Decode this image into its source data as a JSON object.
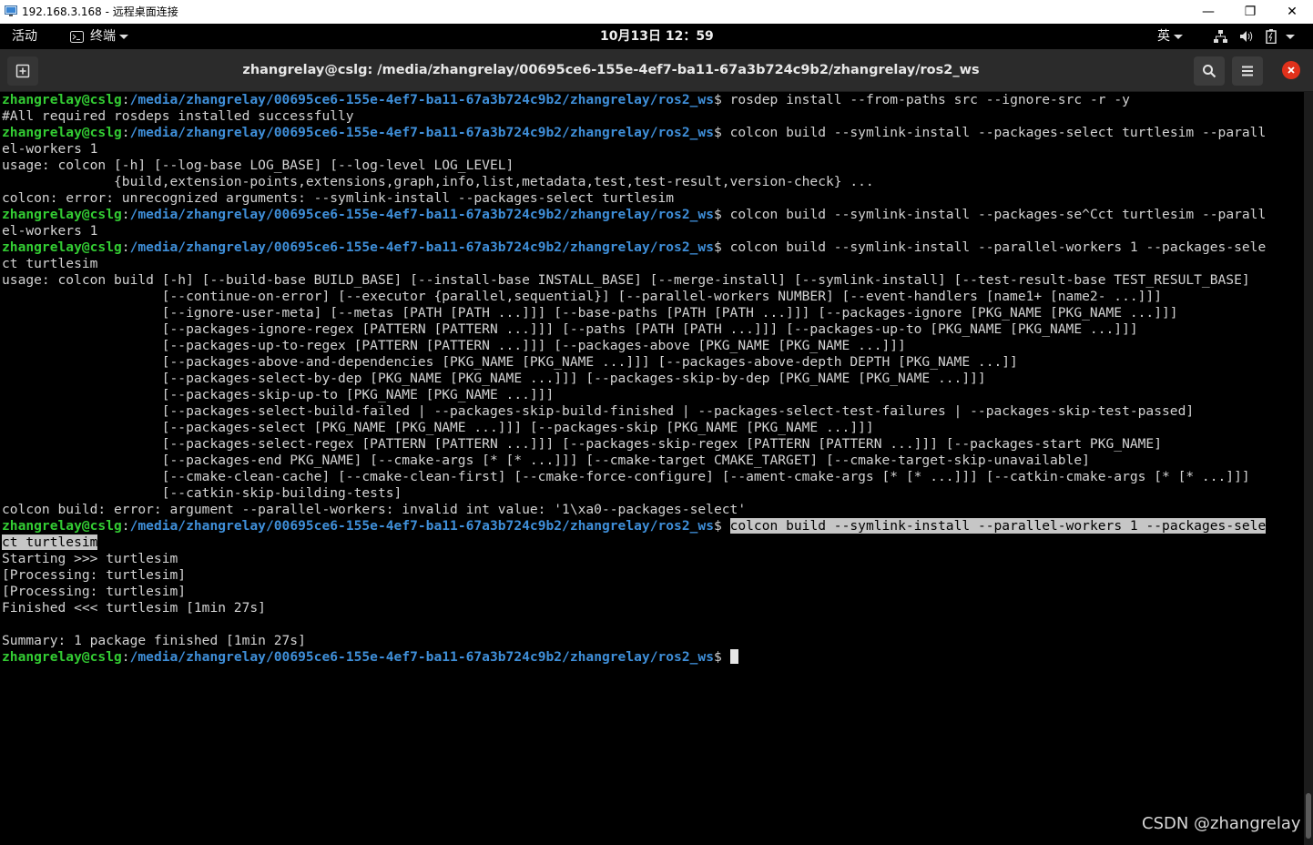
{
  "rdp_window": {
    "title": "192.168.3.168 - 远程桌面连接",
    "minimize_glyph": "—",
    "restore_glyph": "❐",
    "close_glyph": "✕"
  },
  "gnome_bar": {
    "activities": "活动",
    "app_menu": "终端",
    "clock": "10月13日 12：59",
    "input_method": "英",
    "status_icons": [
      "network-icon",
      "volume-icon",
      "battery-icon"
    ]
  },
  "terminal": {
    "title": "zhangrelay@cslg: /media/zhangrelay/00695ce6-155e-4ef7-ba11-67a3b724c9b2/zhangrelay/ros2_ws",
    "prompt_user": "zhangrelay@cslg",
    "prompt_sep": ":",
    "prompt_path": "/media/zhangrelay/00695ce6-155e-4ef7-ba11-67a3b724c9b2/zhangrelay/ros2_ws",
    "prompt_end": "$ ",
    "lines": [
      {
        "type": "prompt",
        "cmd": "rosdep install --from-paths src --ignore-src -r -y"
      },
      {
        "type": "out",
        "text": "#All required rosdeps installed successfully"
      },
      {
        "type": "prompt",
        "cmd": "colcon build --symlink-install --packages-select turtlesim --parall"
      },
      {
        "type": "out",
        "text": "el-workers 1"
      },
      {
        "type": "out",
        "text": "usage: colcon [-h] [--log-base LOG_BASE] [--log-level LOG_LEVEL]"
      },
      {
        "type": "out",
        "text": "              {build,extension-points,extensions,graph,info,list,metadata,test,test-result,version-check} ..."
      },
      {
        "type": "out",
        "text": "colcon: error: unrecognized arguments: --symlink-install --packages-select turtlesim"
      },
      {
        "type": "prompt",
        "cmd": "colcon build --symlink-install --packages-se^Cct turtlesim --parall"
      },
      {
        "type": "out",
        "text": "el-workers 1"
      },
      {
        "type": "prompt",
        "cmd": "colcon build --symlink-install --parallel-workers 1 --packages-sele"
      },
      {
        "type": "out",
        "text": "ct turtlesim"
      },
      {
        "type": "out",
        "text": "usage: colcon build [-h] [--build-base BUILD_BASE] [--install-base INSTALL_BASE] [--merge-install] [--symlink-install] [--test-result-base TEST_RESULT_BASE]"
      },
      {
        "type": "out",
        "text": "                    [--continue-on-error] [--executor {parallel,sequential}] [--parallel-workers NUMBER] [--event-handlers [name1+ [name2- ...]]]"
      },
      {
        "type": "out",
        "text": "                    [--ignore-user-meta] [--metas [PATH [PATH ...]]] [--base-paths [PATH [PATH ...]]] [--packages-ignore [PKG_NAME [PKG_NAME ...]]]"
      },
      {
        "type": "out",
        "text": "                    [--packages-ignore-regex [PATTERN [PATTERN ...]]] [--paths [PATH [PATH ...]]] [--packages-up-to [PKG_NAME [PKG_NAME ...]]]"
      },
      {
        "type": "out",
        "text": "                    [--packages-up-to-regex [PATTERN [PATTERN ...]]] [--packages-above [PKG_NAME [PKG_NAME ...]]]"
      },
      {
        "type": "out",
        "text": "                    [--packages-above-and-dependencies [PKG_NAME [PKG_NAME ...]]] [--packages-above-depth DEPTH [PKG_NAME ...]]"
      },
      {
        "type": "out",
        "text": "                    [--packages-select-by-dep [PKG_NAME [PKG_NAME ...]]] [--packages-skip-by-dep [PKG_NAME [PKG_NAME ...]]]"
      },
      {
        "type": "out",
        "text": "                    [--packages-skip-up-to [PKG_NAME [PKG_NAME ...]]]"
      },
      {
        "type": "out",
        "text": "                    [--packages-select-build-failed | --packages-skip-build-finished | --packages-select-test-failures | --packages-skip-test-passed]"
      },
      {
        "type": "out",
        "text": "                    [--packages-select [PKG_NAME [PKG_NAME ...]]] [--packages-skip [PKG_NAME [PKG_NAME ...]]]"
      },
      {
        "type": "out",
        "text": "                    [--packages-select-regex [PATTERN [PATTERN ...]]] [--packages-skip-regex [PATTERN [PATTERN ...]]] [--packages-start PKG_NAME]"
      },
      {
        "type": "out",
        "text": "                    [--packages-end PKG_NAME] [--cmake-args [* [* ...]]] [--cmake-target CMAKE_TARGET] [--cmake-target-skip-unavailable]"
      },
      {
        "type": "out",
        "text": "                    [--cmake-clean-cache] [--cmake-clean-first] [--cmake-force-configure] [--ament-cmake-args [* [* ...]]] [--catkin-cmake-args [* [* ...]]]"
      },
      {
        "type": "out",
        "text": "                    [--catkin-skip-building-tests]"
      },
      {
        "type": "out",
        "text": "colcon build: error: argument --parallel-workers: invalid int value: '1\\xa0--packages-select'"
      },
      {
        "type": "prompt",
        "cmd": "colcon build --symlink-install --parallel-workers 1 --packages-sele",
        "selected": true
      },
      {
        "type": "out",
        "text": "ct turtlesim",
        "selected": true
      },
      {
        "type": "out",
        "text": "Starting >>> turtlesim"
      },
      {
        "type": "out",
        "text": "[Processing: turtlesim]"
      },
      {
        "type": "out",
        "text": "[Processing: turtlesim]"
      },
      {
        "type": "out",
        "text": "Finished <<< turtlesim [1min 27s]"
      },
      {
        "type": "out",
        "text": ""
      },
      {
        "type": "out",
        "text": "Summary: 1 package finished [1min 27s]"
      },
      {
        "type": "prompt",
        "cmd": "",
        "cursor": true
      }
    ]
  },
  "watermark": "CSDN @zhangrelay",
  "colors": {
    "prompt_user": "#33cc33",
    "prompt_path": "#3f8fd9",
    "close_button": "#e0311b"
  }
}
